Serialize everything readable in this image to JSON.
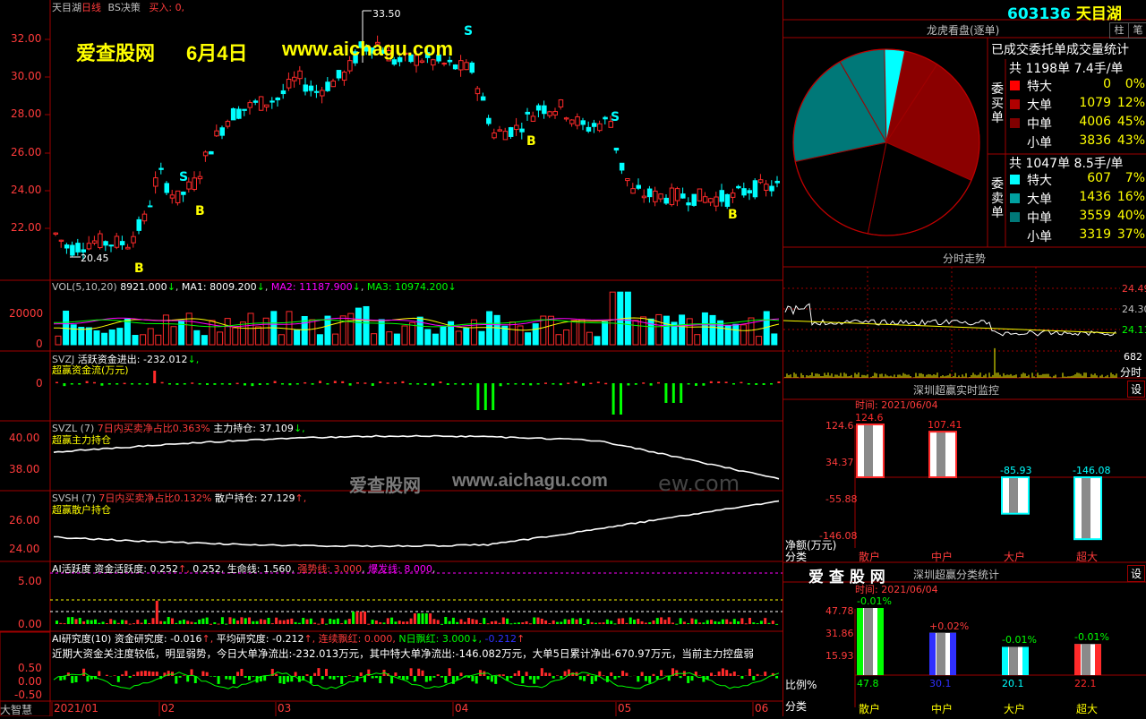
{
  "colors": {
    "up": "#ff2a2a",
    "down": "#00ffff",
    "bg": "#000000",
    "grid": "#a00000",
    "yellow": "#ffff00",
    "green": "#00ff00",
    "white": "#ffffff",
    "magenta": "#ff00ff",
    "blue": "#3030ff"
  },
  "main": {
    "stock_name": "天目湖",
    "period": "日线",
    "indicator": "BS决策",
    "signal_label": "买入:",
    "signal_value": "0,",
    "y_ticks": [
      "32.00",
      "30.00",
      "28.00",
      "26.00",
      "24.00",
      "22.00"
    ],
    "high_label": "33.50",
    "low_label": "20.45",
    "watermark_site": "爱查股网",
    "watermark_date": "6月4日",
    "watermark_url": "www.aichagu.com",
    "b_marker": "B",
    "s_marker": "S"
  },
  "vol": {
    "prefix": "VOL(5,10,20)",
    "vol_value": "8921.000",
    "ma1_label": "MA1:",
    "ma1_value": "8009.200",
    "ma2_label": "MA2:",
    "ma2_value": "11187.900",
    "ma3_label": "MA3:",
    "ma3_value": "10974.200",
    "arrow_down": "↓",
    "y_ticks": [
      "20000",
      "0"
    ]
  },
  "svzj": {
    "name": "SVZJ",
    "label": "活跃资金进出:",
    "value": "-232.012",
    "arrow": "↓,",
    "sub": "超赢资金流(万元)",
    "y_tick": "0"
  },
  "svzl": {
    "name": "SVZL",
    "period": "(7)",
    "label1": "7日内买卖净占比",
    "value1": "0.363%",
    "label2": "主力持仓:",
    "value2": "37.109",
    "arrow": "↓,",
    "sub": "超赢主力持仓",
    "y_ticks": [
      "40.00",
      "38.00"
    ]
  },
  "svsh": {
    "name": "SVSH",
    "period": "(7)",
    "label1": "7日内买卖净占比",
    "value1": "0.132%",
    "label2": "散户持仓:",
    "value2": "27.129",
    "arrow": "↑,",
    "sub": "超赢散户持仓",
    "y_ticks": [
      "26.00",
      "24.00"
    ]
  },
  "ai": {
    "name": "AI活跃度",
    "label": "资金活跃度:",
    "v1": "0.252",
    "a1": "↑,",
    "v2": "0.252",
    "l3": "生命线:",
    "v3": "1.560",
    "l4": "强势线:",
    "v4": "3.000",
    "l5": "爆发线:",
    "v5": "8.000",
    "y_ticks": [
      "5.00",
      "0.00"
    ]
  },
  "research": {
    "name": "AI研究度(10)",
    "l1": "资金研究度:",
    "v1": "-0.016",
    "a1": "↑,",
    "l2": "平均研究度:",
    "v2": "-0.212",
    "a2": "↑,",
    "l3": "连续飘红:",
    "v3": "0.000,",
    "l4": "N日飘红:",
    "v4": "3.000",
    "a4": "↓,",
    "v5": "-0.212",
    "a5": "↑",
    "comment": "近期大资金关注度较低，明显弱势，今日大单净流出:-232.013万元，其中特大单净流出:-146.082万元，大单5日累计净出-670.97万元，当前主力控盘弱",
    "y_ticks": [
      "0.50",
      "0.00",
      "-0.50"
    ]
  },
  "xaxis": {
    "labels": [
      "2021/01",
      "02",
      "03",
      "04",
      "05",
      "06"
    ],
    "logo": "大智慧"
  },
  "watermark_center": {
    "site": "爱查股网",
    "url": "www.aichagu.com",
    "tail": "ew.com"
  },
  "right": {
    "code": "603136",
    "name": "天目湖",
    "btn_zhu": "柱",
    "btn_bi": "笔",
    "pie_title": "龙虎看盘(逐单)",
    "stats_title": "已成交委托单成交量统计",
    "buy": {
      "side_label": "委买单",
      "total_prefix": "共",
      "total": "1198单",
      "per": "7.4手/单",
      "rows": [
        {
          "label": "特大",
          "value": "0",
          "pct": "0%",
          "color": "#ff0000"
        },
        {
          "label": "大单",
          "value": "1079",
          "pct": "12%",
          "color": "#b00000"
        },
        {
          "label": "中单",
          "value": "4006",
          "pct": "45%",
          "color": "#800000"
        },
        {
          "label": "小单",
          "value": "3836",
          "pct": "43%",
          "color": "#000000"
        }
      ]
    },
    "sell": {
      "side_label": "委卖单",
      "total_prefix": "共",
      "total": "1047单",
      "per": "8.5手/单",
      "rows": [
        {
          "label": "特大",
          "value": "607",
          "pct": "7%",
          "color": "#00ffff"
        },
        {
          "label": "大单",
          "value": "1436",
          "pct": "16%",
          "color": "#00a0a0"
        },
        {
          "label": "中单",
          "value": "3559",
          "pct": "40%",
          "color": "#007878"
        },
        {
          "label": "小单",
          "value": "3319",
          "pct": "37%",
          "color": "#000000"
        }
      ]
    },
    "pie": {
      "slices": [
        {
          "label": "特大买",
          "pct": 0,
          "color": "#ff0000"
        },
        {
          "label": "大单买",
          "pct": 6.0,
          "color": "#8b0000"
        },
        {
          "label": "中单买",
          "pct": 22.5,
          "color": "#8b0000"
        },
        {
          "label": "小单买",
          "pct": 21.5,
          "color": "#000000"
        },
        {
          "label": "小单卖",
          "pct": 18.5,
          "color": "#000000"
        },
        {
          "label": "中单卖",
          "pct": 20.0,
          "color": "#007878"
        },
        {
          "label": "大单卖",
          "pct": 8.0,
          "color": "#007878"
        },
        {
          "label": "特大卖",
          "pct": 3.5,
          "color": "#00ffff"
        }
      ]
    },
    "intraday": {
      "title": "分时走势",
      "p1": "24.49",
      "p2": "24.30",
      "p3": "24.11",
      "vol": "682",
      "tab": "分时"
    },
    "monitor": {
      "title": "深圳超赢实时监控",
      "btn": "设",
      "time_label": "时间:",
      "time": "2021/06/04",
      "y_ticks": [
        "124.6",
        "34.37",
        "-55.88",
        "-146.08"
      ],
      "unit": "净额(万元)",
      "axis_label": "分类",
      "bars": [
        {
          "label": "散户",
          "value": 124.6,
          "text": "124.6",
          "color": "#ff2a2a"
        },
        {
          "label": "中户",
          "value": 107.41,
          "text": "107.41",
          "color": "#ff2a2a"
        },
        {
          "label": "大户",
          "value": -85.93,
          "text": "-85.93",
          "color": "#00ffff"
        },
        {
          "label": "超大",
          "value": -146.08,
          "text": "-146.08",
          "color": "#00ffff"
        }
      ]
    },
    "stats": {
      "logo": "爱 查 股 网",
      "title": "深圳超赢分类统计",
      "btn": "设",
      "time_label": "时间:",
      "time": "2021/06/04",
      "y_ticks": [
        "47.78",
        "31.86",
        "15.93"
      ],
      "ratio_label": "比例%",
      "axis_label": "分类",
      "bars": [
        {
          "label": "散户",
          "value": 47.8,
          "top": "-0.01%",
          "bottom": "47.8",
          "color": "#00ff00"
        },
        {
          "label": "中户",
          "value": 30.1,
          "top": "+0.02%",
          "bottom": "30.1",
          "color": "#3030ff"
        },
        {
          "label": "大户",
          "value": 20.1,
          "top": "-0.01%",
          "bottom": "20.1",
          "color": "#00ffff"
        },
        {
          "label": "超大",
          "value": 22.1,
          "top": "-0.01%",
          "bottom": "22.1",
          "color": "#ff2a2a"
        }
      ]
    }
  }
}
